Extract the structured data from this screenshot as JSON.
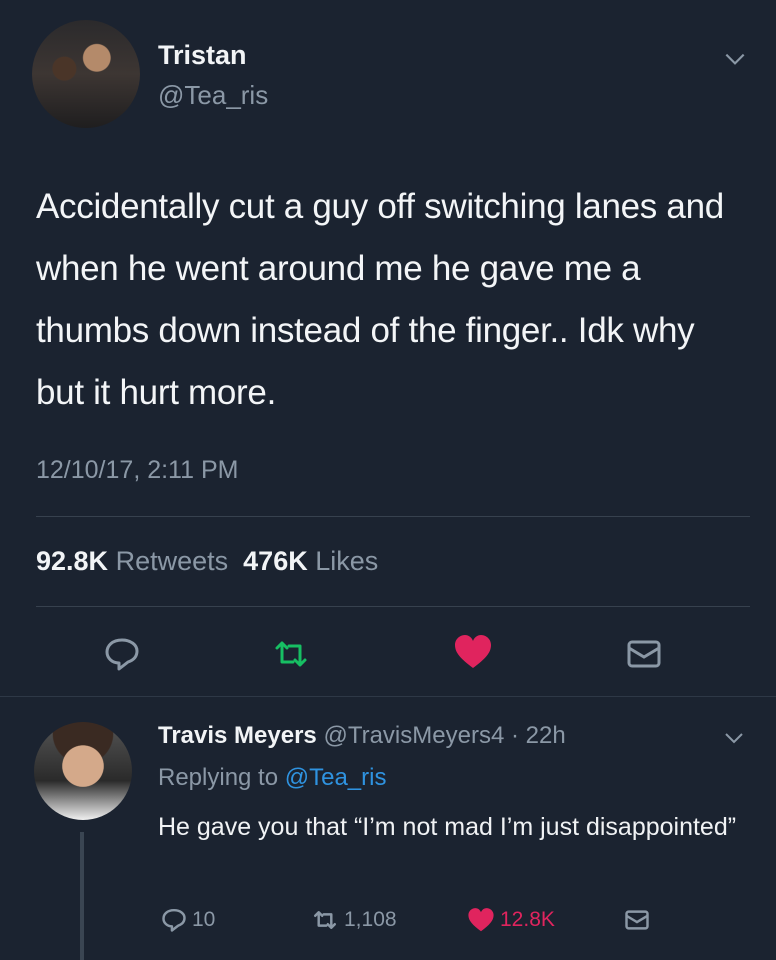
{
  "colors": {
    "background": "#1b2330",
    "muted": "#8b98a6",
    "retweet_green": "#17bf63",
    "like_red": "#e0245e",
    "link_blue": "#2f93e0"
  },
  "tweet": {
    "author_name": "Tristan",
    "author_handle": "@Tea_ris",
    "text": "Accidentally cut a guy off switching lanes and when he went around me he gave me a thumbs down instead of the finger.. Idk why but it hurt more.",
    "timestamp": "12/10/17, 2:11 PM",
    "retweets_count": "92.8K",
    "retweets_label": "Retweets",
    "likes_count": "476K",
    "likes_label": "Likes",
    "icons": [
      "reply-icon",
      "retweet-icon",
      "heart-icon",
      "dm-icon"
    ]
  },
  "reply": {
    "author_name": "Travis Meyers",
    "author_handle": "@TravisMeyers4",
    "time": "· 22h",
    "replying_prefix": "Replying to",
    "replying_handle": "@Tea_ris",
    "text": "He gave you that “I’m not mad I’m just disappointed”",
    "reply_count": "10",
    "retweet_count": "1,108",
    "like_count": "12.8K"
  }
}
